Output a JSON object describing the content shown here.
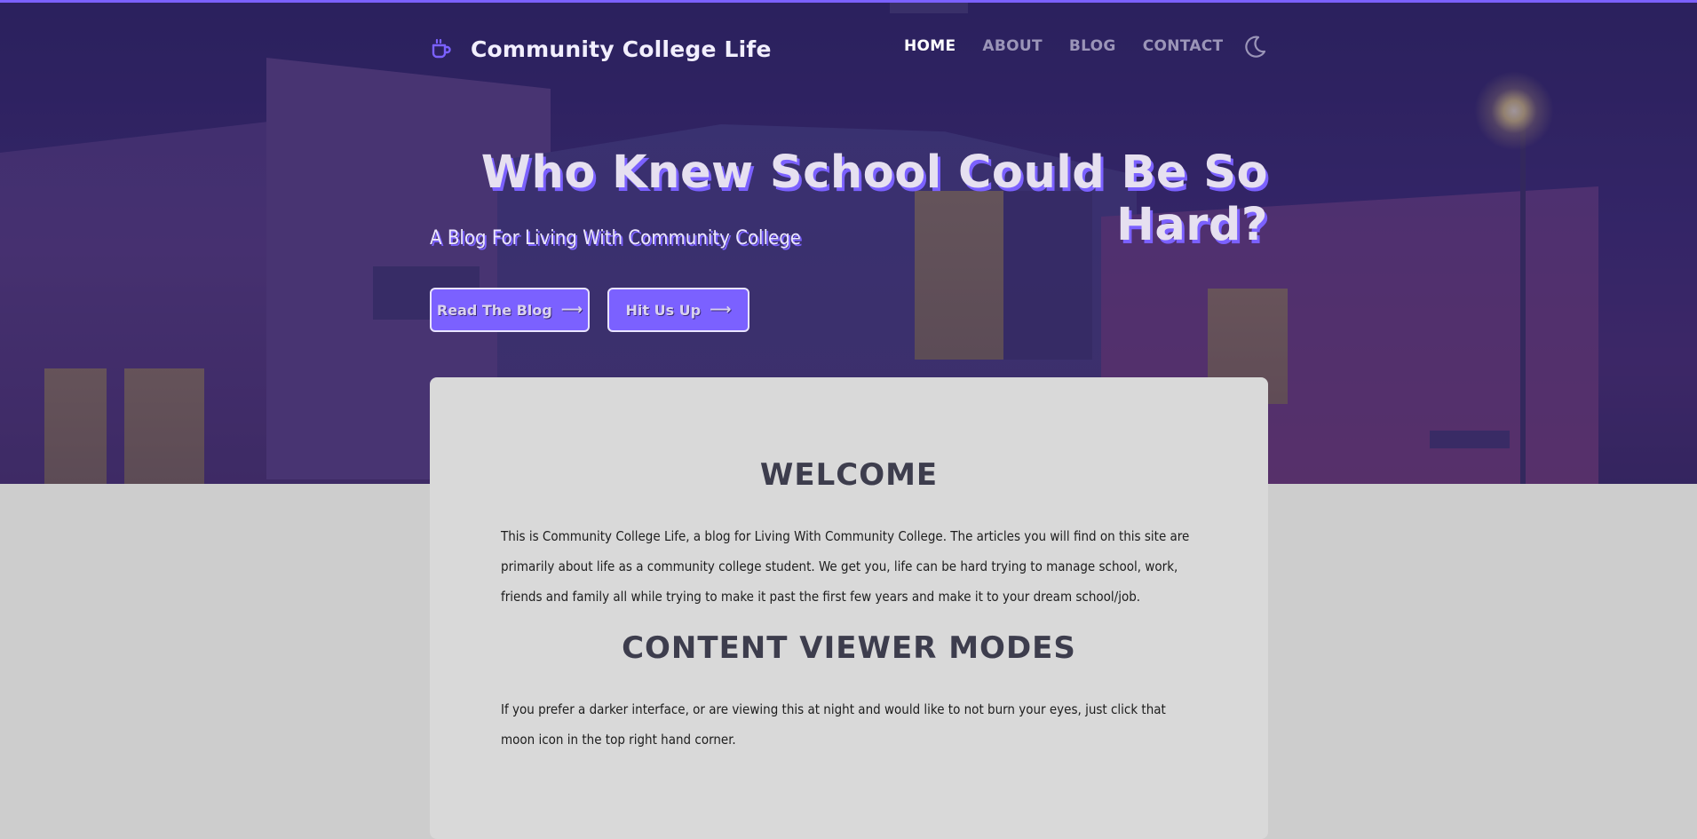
{
  "colors": {
    "accent": "#7b61ff",
    "page_background": "#cdcdcd",
    "card_background": "#d9d9d9",
    "heading": "#3d3d4d"
  },
  "nav": {
    "brand_icon": "coffee-mug-icon",
    "brand_title": "Community College Life",
    "links": [
      {
        "label": "HOME",
        "active": true
      },
      {
        "label": "ABOUT",
        "active": false
      },
      {
        "label": "BLOG",
        "active": false
      },
      {
        "label": "CONTACT",
        "active": false
      }
    ],
    "theme_toggle_icon": "moon-icon"
  },
  "hero": {
    "headline": "Who Knew School Could Be So Hard?",
    "subheadline": "A Blog For Living With Community College",
    "buttons": [
      {
        "label": "Read The Blog",
        "icon": "arrow-right-icon"
      },
      {
        "label": "Hit Us Up",
        "icon": "arrow-right-icon"
      }
    ]
  },
  "content": {
    "welcome_heading": "WELCOME",
    "welcome_text": "This is Community College Life, a blog for Living With Community College. The articles you will find on this site are primarily about life as a community college student. We get you, life can be hard trying to manage school, work, friends and family all while trying to make it past the first few years and make it to your dream school/job.",
    "modes_heading": "CONTENT VIEWER MODES",
    "modes_text": "If you prefer a darker interface, or are viewing this at night and would like to not burn your eyes, just click that moon icon in the top right hand corner."
  }
}
